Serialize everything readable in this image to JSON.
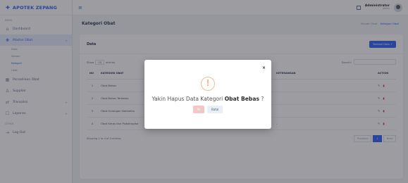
{
  "app": {
    "brand": "APOTEK ZEPANG",
    "logo_glyph": "✚"
  },
  "sidebar": {
    "section_menu": "MENU",
    "items": [
      {
        "label": "Dashboard",
        "icon": "home-icon",
        "glyph": "⌂"
      },
      {
        "label": "Master Obat",
        "icon": "pill-icon",
        "glyph": "❋"
      }
    ],
    "sub_items": [
      "Data",
      "Satuan",
      "Kategori",
      "Obat"
    ],
    "items2": [
      {
        "label": "Persediaan Obat",
        "icon": "box-icon",
        "glyph": "▦"
      },
      {
        "label": "Supplier",
        "icon": "users-icon",
        "glyph": "♙"
      },
      {
        "label": "Transaksi",
        "icon": "exchange-icon",
        "glyph": "⇄"
      },
      {
        "label": "Laporan",
        "icon": "report-icon",
        "glyph": "☐"
      }
    ],
    "section_other": "OTHER",
    "logout": "Log Out"
  },
  "topbar": {
    "username": "Administrator",
    "role": "Admin"
  },
  "page": {
    "title": "Kategori Obat",
    "breadcrumb_root": "Master Obat",
    "breadcrumb_current": "Kategori Obat"
  },
  "card": {
    "title": "Data",
    "add_button": "Tambah Data +",
    "show_label": "Show",
    "show_value": "10",
    "entries_label": "entries",
    "search_label": "Search:",
    "columns": [
      "NO",
      "KATEGORI OBAT",
      "KETERANGAN",
      "ACTION"
    ],
    "rows": [
      {
        "no": "1",
        "kategori": "Obat Bebas",
        "keterangan": ""
      },
      {
        "no": "2",
        "kategori": "Obat Bebas Terbatas",
        "keterangan": ""
      },
      {
        "no": "3",
        "kategori": "Obat Golongan Narkotika",
        "keterangan": ""
      },
      {
        "no": "4",
        "kategori": "Obat Keras dan Psikotropika",
        "keterangan": "-"
      }
    ],
    "showing_text": "Showing 1 to 4 of 4 entries",
    "pager": {
      "prev": "Previous",
      "page": "1",
      "next": "Next"
    }
  },
  "modal": {
    "close_glyph": "×",
    "warning_glyph": "!",
    "message_prefix": "Yakin Hapus Data Kategori ",
    "message_item": "Obat Bebas",
    "message_suffix": " ?",
    "yes_label": "Ya",
    "no_label": "Batal"
  },
  "colors": {
    "accent": "#3b6cf6",
    "warning": "#f8bb86",
    "danger": "#dc3545",
    "success": "#28a745"
  }
}
